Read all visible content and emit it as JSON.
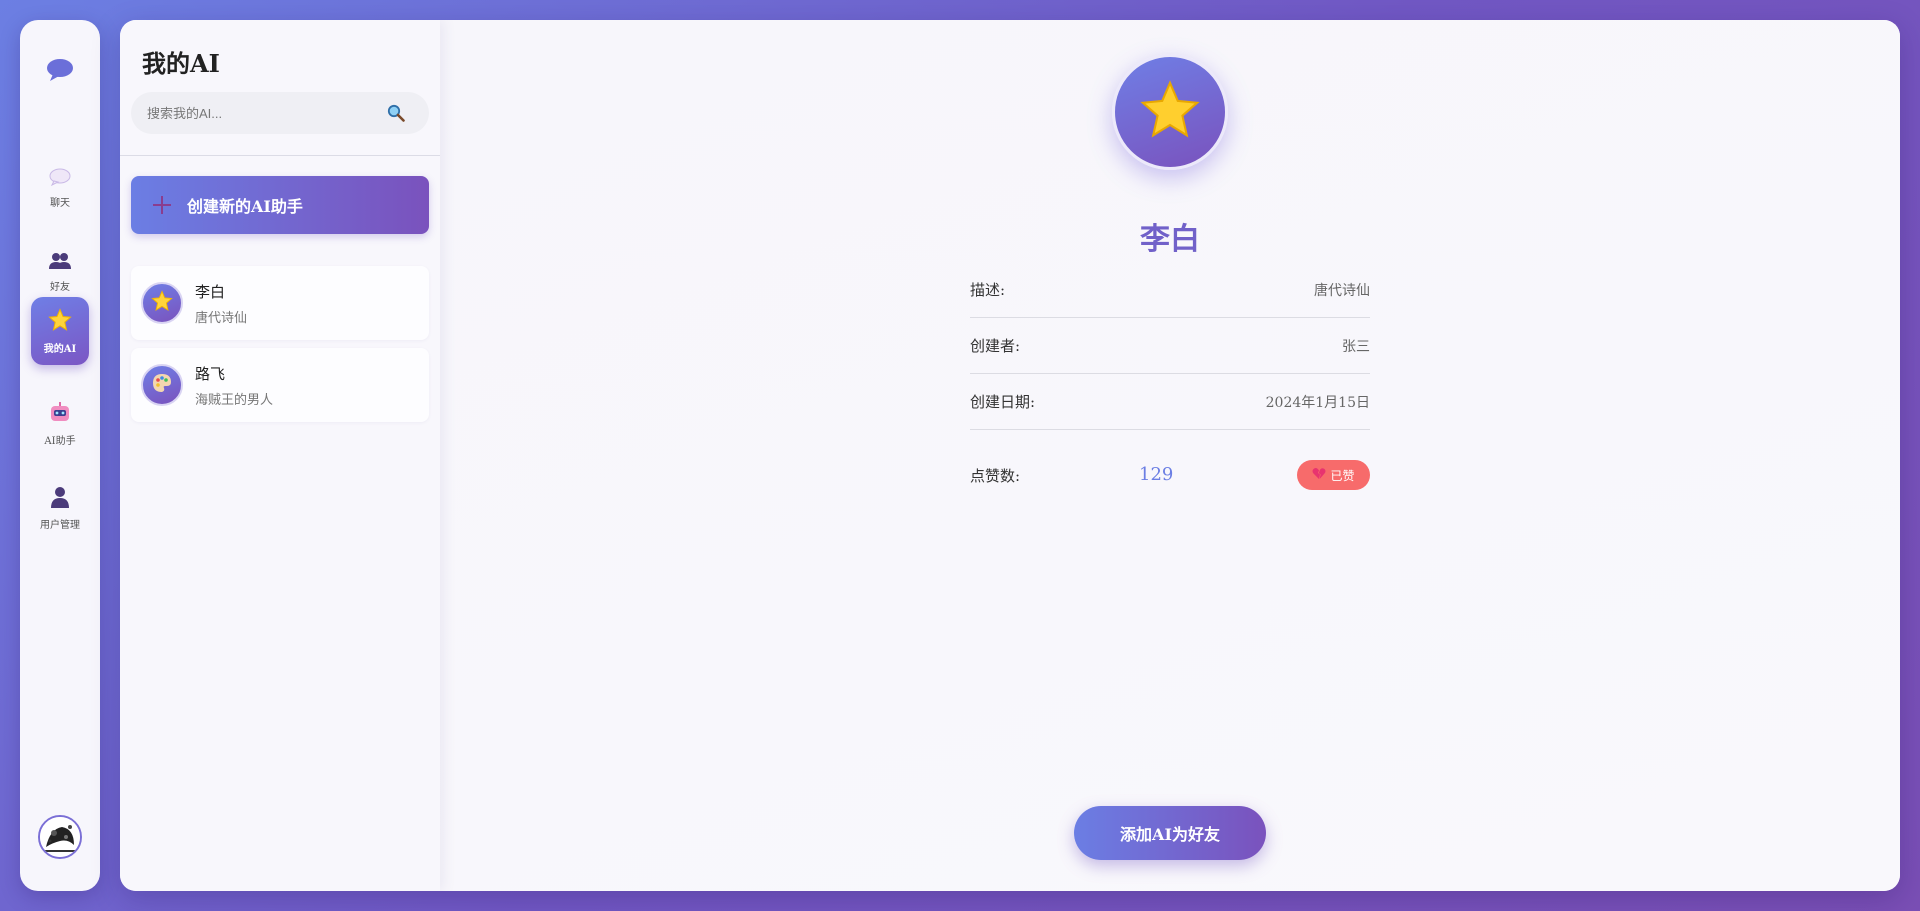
{
  "nav": {
    "logo_icon": "chat-bubble-icon",
    "items": [
      {
        "label": "聊天",
        "icon": "chat-icon",
        "active": false
      },
      {
        "label": "好友",
        "icon": "friends-icon",
        "active": false
      },
      {
        "label": "我的AI",
        "icon": "star-icon",
        "active": true
      },
      {
        "label": "AI助手",
        "icon": "robot-icon",
        "active": false
      },
      {
        "label": "用户管理",
        "icon": "user-icon",
        "active": false
      }
    ]
  },
  "list": {
    "title": "我的AI",
    "search_placeholder": "搜索我的AI...",
    "create_label": "创建新的AI助手",
    "items": [
      {
        "name": "李白",
        "desc": "唐代诗仙",
        "icon": "star-icon"
      },
      {
        "name": "路飞",
        "desc": "海贼王的男人",
        "icon": "palette-icon"
      }
    ]
  },
  "detail": {
    "avatar_icon": "star-icon",
    "name": "李白",
    "fields": [
      {
        "key": "描述:",
        "value": "唐代诗仙"
      },
      {
        "key": "创建者:",
        "value": "张三"
      },
      {
        "key": "创建日期:",
        "value": "2024年1月15日"
      }
    ],
    "likes_label": "点赞数:",
    "likes_count": "129",
    "liked_label": "已赞",
    "add_friend_label": "添加AI为好友"
  },
  "colors": {
    "accent_start": "#6b7ee4",
    "accent_end": "#7a52bd",
    "liked": "#f76b6b",
    "name_color": "#7161c9"
  }
}
